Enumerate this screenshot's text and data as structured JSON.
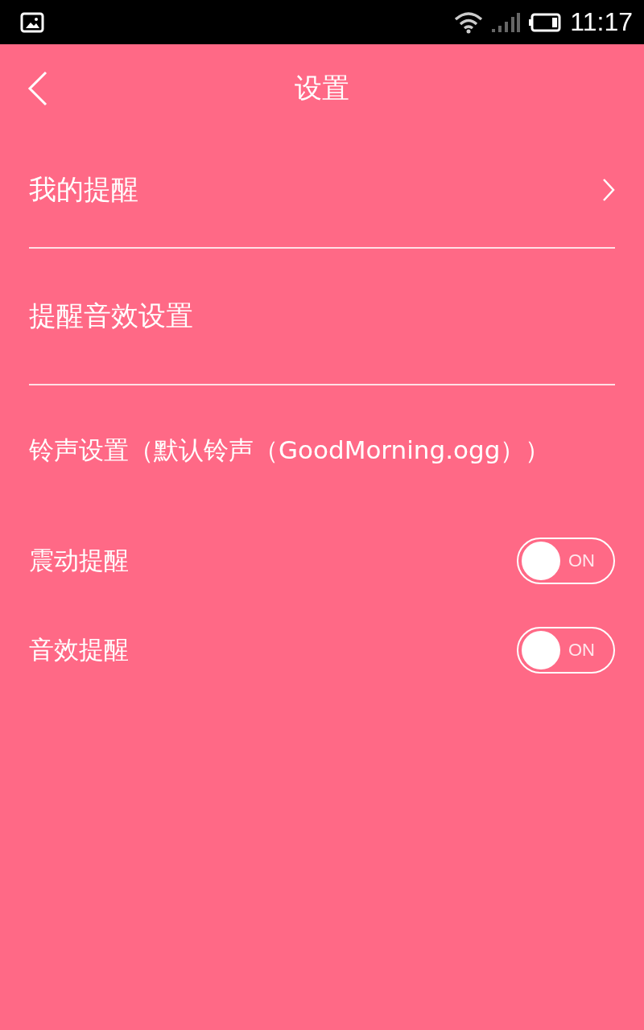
{
  "status_bar": {
    "time": "11:17"
  },
  "header": {
    "title": "设置"
  },
  "sections": [
    {
      "kind": "link",
      "label": "我的提醒"
    },
    {
      "kind": "heading",
      "label": "提醒音效设置"
    }
  ],
  "settings": [
    {
      "kind": "text",
      "label": "铃声设置（默认铃声（GoodMorning.ogg））"
    },
    {
      "kind": "toggle",
      "label": "震动提醒",
      "on": true,
      "state_label": "ON"
    },
    {
      "kind": "toggle",
      "label": "音效提醒",
      "on": true,
      "state_label": "ON"
    }
  ]
}
